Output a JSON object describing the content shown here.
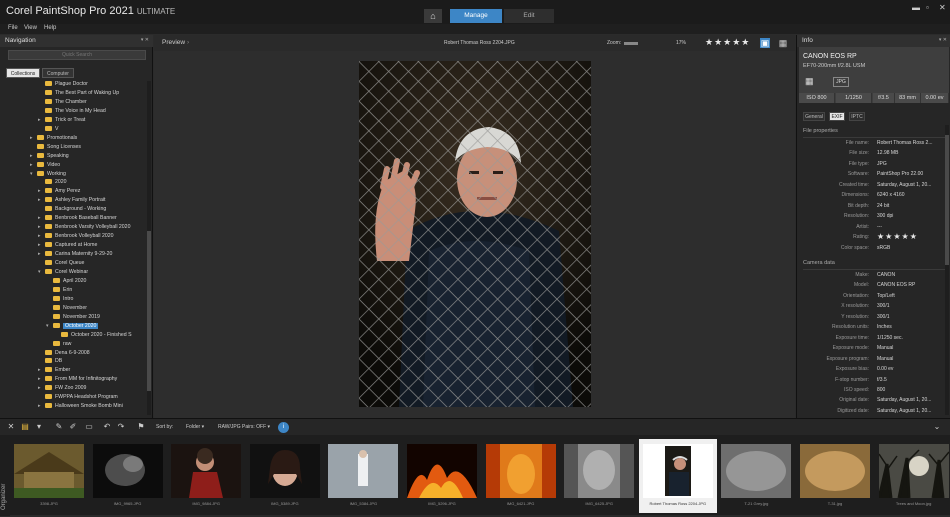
{
  "app": {
    "title": "Corel PaintShop Pro 2021",
    "edition": "ULTIMATE",
    "tabs": [
      "Manage",
      "Edit"
    ],
    "home_icon": "home-icon"
  },
  "menu": [
    "File",
    "View",
    "Help"
  ],
  "navigation": {
    "title": "Navigation",
    "search_placeholder": "Quick Search",
    "tabs": [
      "Collections",
      "Computer"
    ],
    "tree": [
      {
        "label": "Plague Doctor",
        "indent": 3,
        "arrow": ""
      },
      {
        "label": "The Best Part of Waking Up",
        "indent": 3,
        "arrow": ""
      },
      {
        "label": "The Chamber",
        "indent": 3,
        "arrow": ""
      },
      {
        "label": "The Voice in My Head",
        "indent": 3,
        "arrow": ""
      },
      {
        "label": "Trick or Treat",
        "indent": 3,
        "arrow": "▸"
      },
      {
        "label": "V",
        "indent": 3,
        "arrow": ""
      },
      {
        "label": "Promotionals",
        "indent": 2,
        "arrow": "▸"
      },
      {
        "label": "Song Licenses",
        "indent": 2,
        "arrow": ""
      },
      {
        "label": "Speaking",
        "indent": 2,
        "arrow": "▸"
      },
      {
        "label": "Video",
        "indent": 2,
        "arrow": "▸"
      },
      {
        "label": "Working",
        "indent": 2,
        "arrow": "▾"
      },
      {
        "label": "2020",
        "indent": 3,
        "arrow": ""
      },
      {
        "label": "Amy Perez",
        "indent": 3,
        "arrow": "▸"
      },
      {
        "label": "Ashley Family Portrait",
        "indent": 3,
        "arrow": "▸"
      },
      {
        "label": "Background - Working",
        "indent": 3,
        "arrow": ""
      },
      {
        "label": "Benbrook Baseball Banner",
        "indent": 3,
        "arrow": "▸"
      },
      {
        "label": "Benbrook Varsity Volleyball 2020",
        "indent": 3,
        "arrow": "▸"
      },
      {
        "label": "Benbrook Volleyball 2020",
        "indent": 3,
        "arrow": "▸"
      },
      {
        "label": "Captured at Home",
        "indent": 3,
        "arrow": "▸"
      },
      {
        "label": "Carina Maternity 9-29-20",
        "indent": 3,
        "arrow": "▸"
      },
      {
        "label": "Corel Queue",
        "indent": 3,
        "arrow": ""
      },
      {
        "label": "Corel Webinar",
        "indent": 3,
        "arrow": "▾"
      },
      {
        "label": "April 2020",
        "indent": 4,
        "arrow": ""
      },
      {
        "label": "Erin",
        "indent": 4,
        "arrow": ""
      },
      {
        "label": "Intro",
        "indent": 4,
        "arrow": ""
      },
      {
        "label": "November",
        "indent": 4,
        "arrow": ""
      },
      {
        "label": "November 2019",
        "indent": 4,
        "arrow": ""
      },
      {
        "label": "October 2020",
        "indent": 4,
        "arrow": "▾",
        "selected": true
      },
      {
        "label": "October 2020 - Finished S",
        "indent": 5,
        "arrow": ""
      },
      {
        "label": "raw",
        "indent": 4,
        "arrow": ""
      },
      {
        "label": "Dena 6-9-2008",
        "indent": 3,
        "arrow": ""
      },
      {
        "label": "DB",
        "indent": 3,
        "arrow": ""
      },
      {
        "label": "Ember",
        "indent": 3,
        "arrow": "▸"
      },
      {
        "label": "From MM for Infinitography",
        "indent": 3,
        "arrow": "▸"
      },
      {
        "label": "FW Zoo 2009",
        "indent": 3,
        "arrow": "▸"
      },
      {
        "label": "FWPPA Headshot Program",
        "indent": 3,
        "arrow": ""
      },
      {
        "label": "Halloween Smoke Bomb Mini",
        "indent": 3,
        "arrow": "▸"
      }
    ]
  },
  "preview": {
    "title": "Preview",
    "filename": "Robert Thomas Ross 2204.JPG",
    "zoom_label": "Zoom:",
    "zoom_value": "17%",
    "rating": "★★★★★"
  },
  "info": {
    "title": "Info",
    "camera": "CANON EOS RP",
    "lens": "EF70-200mm f/2.8L USM",
    "format": "JPG",
    "exposure": [
      "ISO 800",
      "1/1250",
      "f/3.5",
      "83 mm",
      "0.00 ev"
    ],
    "tabs": [
      "General",
      "EXIF",
      "IPTC"
    ],
    "file_props_title": "File properties",
    "file_props": [
      [
        "File name:",
        "Robert Thomas Ross 2..."
      ],
      [
        "File size:",
        "12.98 MB"
      ],
      [
        "File type:",
        "JPG"
      ],
      [
        "Software:",
        "PaintShop Pro 22.00"
      ],
      [
        "Created time:",
        "Saturday, August 1, 20..."
      ],
      [
        "Dimensions:",
        "6240 x 4160"
      ],
      [
        "Bit depth:",
        "24 bit"
      ],
      [
        "Resolution:",
        "300 dpi"
      ],
      [
        "Artist:",
        "---"
      ],
      [
        "Rating:",
        "★★★★★"
      ],
      [
        "Color space:",
        "sRGB"
      ]
    ],
    "camera_data_title": "Camera data",
    "camera_data": [
      [
        "Make:",
        "CANON"
      ],
      [
        "Model:",
        "CANON EOS RP"
      ],
      [
        "Orientation:",
        "Top/Left"
      ],
      [
        "X resolution:",
        "300/1"
      ],
      [
        "Y resolution:",
        "300/1"
      ],
      [
        "Resolution units:",
        "Inches"
      ],
      [
        "Exposure time:",
        "1/1250 sec."
      ],
      [
        "Exposure mode:",
        "Manual"
      ],
      [
        "Exposure program:",
        "Manual"
      ],
      [
        "Exposure bias:",
        "0.00 ev"
      ],
      [
        "F-stop number:",
        "f/3.5"
      ],
      [
        "ISO speed:",
        "800"
      ],
      [
        "Original date:",
        "Saturday, August 1, 20..."
      ],
      [
        "Digitized date:",
        "Saturday, August 1, 20..."
      ]
    ]
  },
  "organizer": {
    "label": "Organizer",
    "sort_by": "Sort by:",
    "sort_value": "Folder",
    "raw_pairs": "RAW/JPG Pairs: OFF",
    "thumbnails": [
      {
        "caption": "3398.JPG",
        "kind": "cottage",
        "selected": false
      },
      {
        "caption": "IMG_9965.JPG",
        "kind": "smoke",
        "selected": false
      },
      {
        "caption": "IMG_9884.JPG",
        "kind": "redjacket",
        "selected": false
      },
      {
        "caption": "IMG_5389.JPG",
        "kind": "woman",
        "selected": false
      },
      {
        "caption": "IMG_5384.JPG",
        "kind": "studio",
        "selected": false
      },
      {
        "caption": "IMG_5296.JPG",
        "kind": "fire",
        "selected": false
      },
      {
        "caption": "IMG_6421.JPG",
        "kind": "flame",
        "selected": false
      },
      {
        "caption": "IMG_6425.JPG",
        "kind": "grey",
        "selected": false
      },
      {
        "caption": "Robert Thomas Ross 2204.JPG",
        "kind": "man",
        "selected": true
      },
      {
        "caption": "T-21 Grey.jpg",
        "kind": "greytex",
        "selected": false
      },
      {
        "caption": "T-31.jpg",
        "kind": "tan",
        "selected": false
      },
      {
        "caption": "Trees and Moon.jpg",
        "kind": "trees",
        "selected": false
      }
    ]
  }
}
